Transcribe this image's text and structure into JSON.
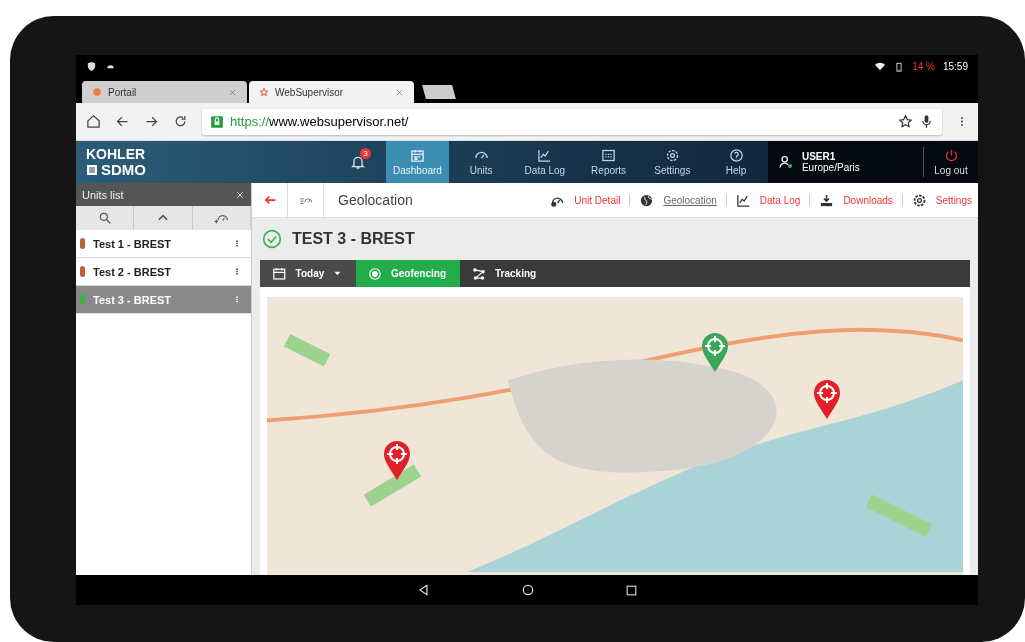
{
  "status_bar": {
    "battery": "14 %",
    "time": "15:59"
  },
  "browser": {
    "tabs": [
      {
        "title": "Portail",
        "selected": false
      },
      {
        "title": "WebSupervisor",
        "selected": true
      }
    ],
    "url_scheme": "https://",
    "url_rest": "www.websupervisor.net/"
  },
  "app": {
    "logo_top": "KOHLER",
    "logo_bottom": "SDMO",
    "notifications": "3",
    "nav": [
      {
        "label": "Dashboard",
        "selected": true
      },
      {
        "label": "Units",
        "selected": false
      },
      {
        "label": "Data Log",
        "selected": false
      },
      {
        "label": "Reports",
        "selected": false
      },
      {
        "label": "Settings",
        "selected": false
      },
      {
        "label": "Help",
        "selected": false
      }
    ],
    "user": {
      "name": "USER1",
      "timezone": "Europe/Paris"
    },
    "logout": "Log out"
  },
  "units_panel": {
    "title": "Units list",
    "units": [
      {
        "name": "Test 1 - BREST",
        "color": "#b4653c",
        "selected": false
      },
      {
        "name": "Test 2 - BREST",
        "color": "#b4653c",
        "selected": false
      },
      {
        "name": "Test 3 - BREST",
        "color": "#3cb44a",
        "selected": true
      }
    ]
  },
  "page": {
    "title": "Geolocation",
    "links": [
      {
        "label": "Unit Detail",
        "selected": false
      },
      {
        "label": "Geolocation",
        "selected": true
      },
      {
        "label": "Data Log",
        "selected": false
      },
      {
        "label": "Downloads",
        "selected": false
      },
      {
        "label": "Settings",
        "selected": false
      }
    ],
    "unit_title": "TEST 3 - BREST",
    "period": "Today",
    "modes": [
      {
        "label": "Geofencing",
        "selected": true
      },
      {
        "label": "Tracking",
        "selected": false
      }
    ],
    "map": {
      "pins": [
        {
          "color": "#e3202a"
        },
        {
          "color": "#3aa85a"
        },
        {
          "color": "#e3202a"
        }
      ]
    }
  }
}
